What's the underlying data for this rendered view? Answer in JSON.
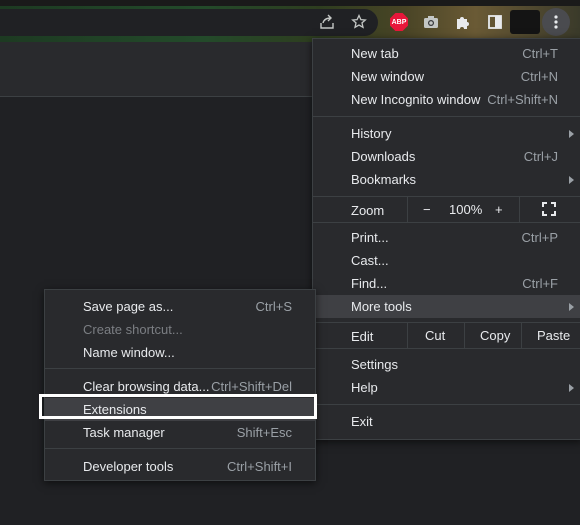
{
  "toolbar": {
    "icons": [
      "share-icon",
      "star-icon",
      "adblock-icon",
      "camera-icon",
      "extensions-puzzle-icon",
      "side-panel-icon",
      "kebab-menu-icon"
    ],
    "adblock_badge": "ABP"
  },
  "main_menu": {
    "new_tab": {
      "label": "New tab",
      "shortcut": "Ctrl+T"
    },
    "new_window": {
      "label": "New window",
      "shortcut": "Ctrl+N"
    },
    "new_incognito": {
      "label": "New Incognito window",
      "shortcut": "Ctrl+Shift+N"
    },
    "history": {
      "label": "History"
    },
    "downloads": {
      "label": "Downloads",
      "shortcut": "Ctrl+J"
    },
    "bookmarks": {
      "label": "Bookmarks"
    },
    "zoom": {
      "label": "Zoom",
      "minus": "−",
      "value": "100%",
      "plus": "+"
    },
    "print": {
      "label": "Print...",
      "shortcut": "Ctrl+P"
    },
    "cast": {
      "label": "Cast..."
    },
    "find": {
      "label": "Find...",
      "shortcut": "Ctrl+F"
    },
    "more_tools": {
      "label": "More tools"
    },
    "edit": {
      "label": "Edit",
      "cut": "Cut",
      "copy": "Copy",
      "paste": "Paste"
    },
    "settings": {
      "label": "Settings"
    },
    "help": {
      "label": "Help"
    },
    "exit": {
      "label": "Exit"
    }
  },
  "more_tools_menu": {
    "save_page": {
      "label": "Save page as...",
      "shortcut": "Ctrl+S"
    },
    "create_shortcut": {
      "label": "Create shortcut..."
    },
    "name_window": {
      "label": "Name window..."
    },
    "clear_browsing": {
      "label": "Clear browsing data...",
      "shortcut": "Ctrl+Shift+Del"
    },
    "extensions": {
      "label": "Extensions"
    },
    "task_manager": {
      "label": "Task manager",
      "shortcut": "Shift+Esc"
    },
    "developer_tools": {
      "label": "Developer tools",
      "shortcut": "Ctrl+Shift+I"
    }
  },
  "colors": {
    "menu_bg": "#292a2d",
    "hover_bg": "#3f4044",
    "highlight_outline": "#ffffff",
    "adblock_red": "#e8173a"
  }
}
